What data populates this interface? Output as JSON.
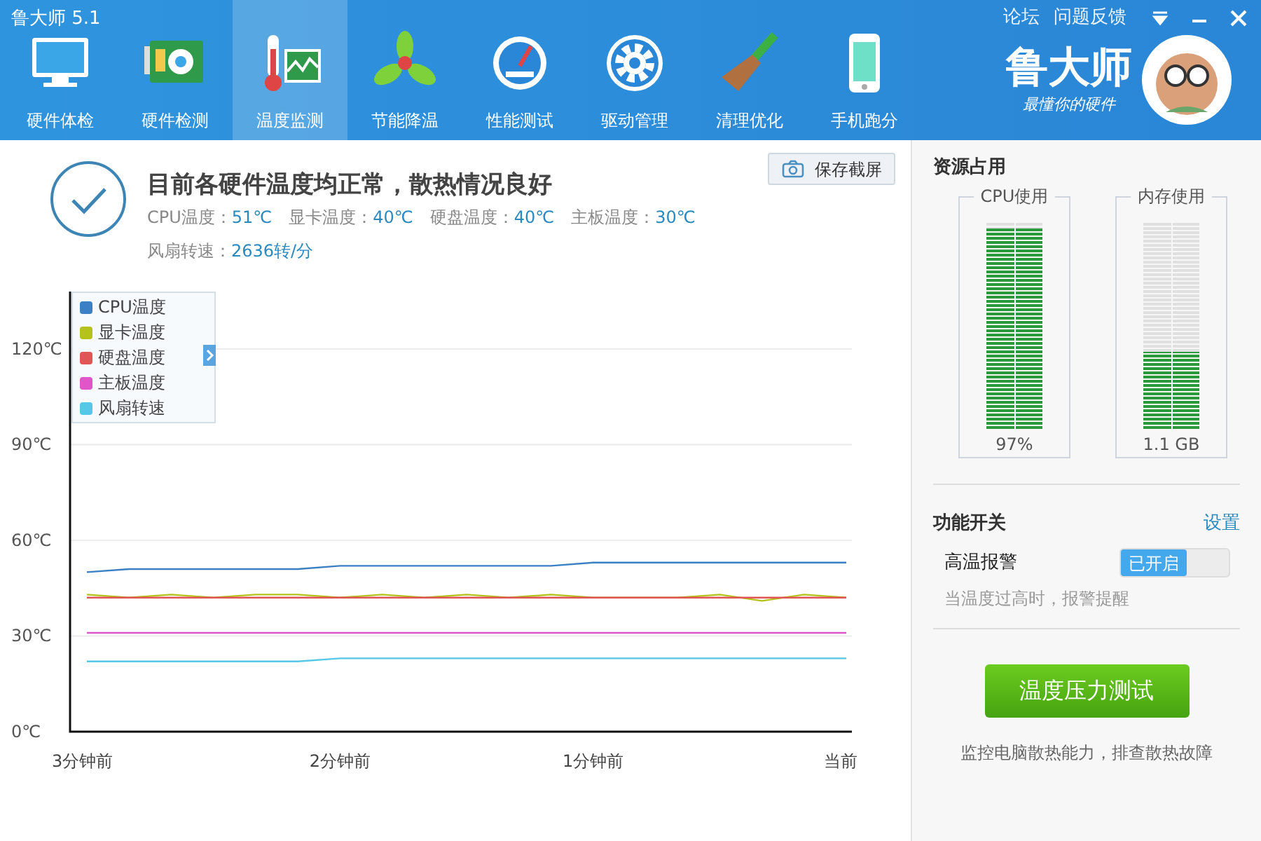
{
  "window": {
    "title": "鲁大师 5.1",
    "links": [
      "论坛",
      "问题反馈"
    ]
  },
  "nav": [
    {
      "label": "硬件体检",
      "selected": false
    },
    {
      "label": "硬件检测",
      "selected": false
    },
    {
      "label": "温度监测",
      "selected": true
    },
    {
      "label": "节能降温",
      "selected": false
    },
    {
      "label": "性能测试",
      "selected": false
    },
    {
      "label": "驱动管理",
      "selected": false
    },
    {
      "label": "清理优化",
      "selected": false
    },
    {
      "label": "手机跑分",
      "selected": false
    }
  ],
  "brand": {
    "name": "鲁大师",
    "slogan": "最懂你的硬件"
  },
  "status": {
    "headline": "目前各硬件温度均正常，散热情况良好",
    "readings": [
      {
        "label": "CPU温度：",
        "value": "51℃"
      },
      {
        "label": "显卡温度：",
        "value": "40℃"
      },
      {
        "label": "硬盘温度：",
        "value": "40℃"
      },
      {
        "label": "主板温度：",
        "value": "30℃"
      },
      {
        "label": "风扇转速：",
        "value": "2636转/分"
      }
    ],
    "screenshot_button": "保存截屏"
  },
  "chart_data": {
    "type": "line",
    "categories": [
      "3分钟前",
      null,
      null,
      null,
      null,
      null,
      "2分钟前",
      null,
      null,
      null,
      null,
      null,
      "1分钟前",
      null,
      null,
      null,
      null,
      null,
      "当前"
    ],
    "ylim": [
      0,
      138
    ],
    "grid": true,
    "legend": true,
    "yticks": [
      {
        "value": 0,
        "label": "0℃"
      },
      {
        "value": 30,
        "label": "30℃"
      },
      {
        "value": 60,
        "label": "60℃"
      },
      {
        "value": 90,
        "label": "90℃"
      },
      {
        "value": 120,
        "label": "120℃"
      }
    ],
    "series": [
      {
        "name": "CPU温度",
        "color": "#3b7fc4",
        "values": [
          50,
          51,
          51,
          51,
          51,
          51,
          52,
          52,
          52,
          52,
          52,
          52,
          53,
          53,
          53,
          53,
          53,
          53,
          53
        ]
      },
      {
        "name": "显卡温度",
        "color": "#b5c21c",
        "values": [
          43,
          42,
          43,
          42,
          43,
          43,
          42,
          43,
          42,
          43,
          42,
          43,
          42,
          42,
          42,
          43,
          41,
          43,
          42
        ]
      },
      {
        "name": "硬盘温度",
        "color": "#e05555",
        "values": [
          42,
          42,
          42,
          42,
          42,
          42,
          42,
          42,
          42,
          42,
          42,
          42,
          42,
          42,
          42,
          42,
          42,
          42,
          42
        ]
      },
      {
        "name": "主板温度",
        "color": "#e055c8",
        "values": [
          31,
          31,
          31,
          31,
          31,
          31,
          31,
          31,
          31,
          31,
          31,
          31,
          31,
          31,
          31,
          31,
          31,
          31,
          31
        ]
      },
      {
        "name": "风扇转速",
        "color": "#55c8e8",
        "values": [
          22,
          22,
          22,
          22,
          22,
          22,
          23,
          23,
          23,
          23,
          23,
          23,
          23,
          23,
          23,
          23,
          23,
          23,
          23
        ]
      }
    ]
  },
  "resources": {
    "title": "资源占用",
    "meters": [
      {
        "label": "CPU使用",
        "level": 0.97,
        "reading": "97%"
      },
      {
        "label": "内存使用",
        "level": 0.37,
        "reading": "1.1 GB"
      }
    ]
  },
  "features": {
    "title": "功能开关",
    "settings_link": "设置",
    "switches": [
      {
        "label": "高温报警",
        "state_text": "已开启",
        "on": true,
        "hint": "当温度过高时，报警提醒"
      }
    ]
  },
  "stress_test": {
    "button": "温度压力测试",
    "caption": "监控电脑散热能力，排查散热故障"
  }
}
